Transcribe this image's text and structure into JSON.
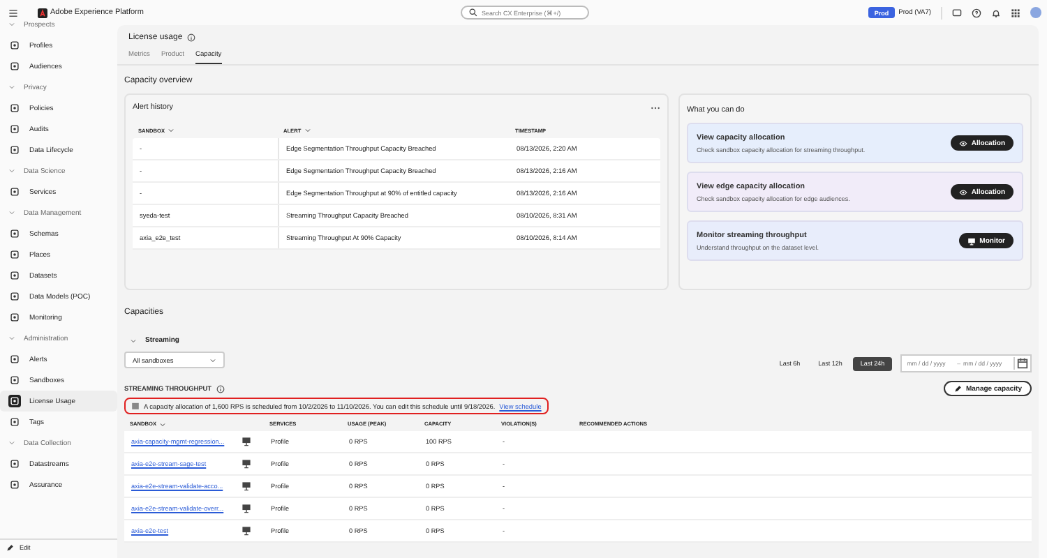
{
  "topbar": {
    "app_name": "Adobe Experience Platform",
    "search_placeholder": "Search CX Enterprise (⌘+/)",
    "env_badge": "Prod",
    "env_name": "Prod (VA7)"
  },
  "sidebar": {
    "sections": [
      {
        "title": "Prospects",
        "expanded": true,
        "items": [
          {
            "label": "Profiles",
            "selected": false
          },
          {
            "label": "Audiences",
            "selected": false
          }
        ]
      },
      {
        "title": "Privacy",
        "expanded": true,
        "items": [
          {
            "label": "Policies",
            "selected": false
          },
          {
            "label": "Audits",
            "selected": false
          },
          {
            "label": "Data Lifecycle",
            "selected": false
          }
        ]
      },
      {
        "title": "Data Science",
        "expanded": true,
        "items": [
          {
            "label": "Services",
            "selected": false
          }
        ]
      },
      {
        "title": "Data Management",
        "expanded": true,
        "items": [
          {
            "label": "Schemas",
            "selected": false
          },
          {
            "label": "Places",
            "selected": false
          },
          {
            "label": "Datasets",
            "selected": false
          },
          {
            "label": "Data Models (POC)",
            "selected": false
          },
          {
            "label": "Monitoring",
            "selected": false
          }
        ]
      },
      {
        "title": "Administration",
        "expanded": true,
        "items": [
          {
            "label": "Alerts",
            "selected": false
          },
          {
            "label": "Sandboxes",
            "selected": false
          },
          {
            "label": "License Usage",
            "selected": true
          },
          {
            "label": "Tags",
            "selected": false
          }
        ]
      },
      {
        "title": "Data Collection",
        "expanded": true,
        "items": [
          {
            "label": "Datastreams",
            "selected": false
          },
          {
            "label": "Assurance",
            "selected": false
          }
        ]
      }
    ],
    "edit_button": "Edit"
  },
  "page": {
    "title": "License usage",
    "tabs": [
      {
        "label": "Metrics",
        "selected": false
      },
      {
        "label": "Product",
        "selected": false
      },
      {
        "label": "Capacity",
        "selected": true
      }
    ],
    "section_title": "Capacity overview"
  },
  "alert_history": {
    "title": "Alert history",
    "columns": [
      {
        "label": "SANDBOX",
        "sortable": true
      },
      {
        "label": "ALERT",
        "sortable": true
      },
      {
        "label": "TIMESTAMP",
        "sortable": false
      }
    ],
    "rows": [
      [
        "-",
        "Edge Segmentation Throughput Capacity Breached",
        "08/13/2026, 2:20 AM"
      ],
      [
        "-",
        "Edge Segmentation Throughput Capacity Breached",
        "08/13/2026, 2:16 AM"
      ],
      [
        "-",
        "Edge Segmentation Throughput at 90% of entitled capacity",
        "08/13/2026, 2:16 AM"
      ],
      [
        "syeda-test",
        "Streaming Throughput Capacity Breached",
        "08/10/2026, 8:31 AM"
      ],
      [
        "axia_e2e_test",
        "Streaming Throughput At 90% Capacity",
        "08/10/2026, 8:14 AM"
      ]
    ]
  },
  "actions": {
    "title": "What you can do",
    "cards": [
      {
        "title": "View capacity allocation",
        "description": "Check sandbox capacity allocation for streaming throughput.",
        "button": "Allocation",
        "kind": "view",
        "color": "#e6eefc"
      },
      {
        "title": "View edge capacity allocation",
        "description": "Check sandbox capacity allocation for edge audiences.",
        "button": "Allocation",
        "kind": "view",
        "color": "#f1ecf9"
      },
      {
        "title": "Monitor streaming throughput",
        "description": "Understand throughput on the dataset level.",
        "button": "Monitor",
        "kind": "monitor",
        "color": "#e8edfb"
      }
    ]
  },
  "capacities": {
    "title": "Capacities",
    "group": {
      "label": "Streaming",
      "expanded": true
    },
    "sandbox_select": "All sandboxes",
    "time_ranges": [
      {
        "label": "Last 6h",
        "selected": false
      },
      {
        "label": "Last 12h",
        "selected": false
      },
      {
        "label": "Last 24h",
        "selected": true
      }
    ],
    "date_start_placeholder": "mm / dd / yyyy",
    "date_separator": "–",
    "date_end_placeholder": "mm / dd / yyyy",
    "throughput_title": "STREAMING THROUGHPUT",
    "manage_button": "Manage capacity",
    "notice": {
      "text": "A capacity allocation of 1,600 RPS is scheduled from 10/2/2026 to 11/10/2026. You can edit this schedule until 9/18/2026.",
      "link": "View schedule",
      "highlighted": true
    },
    "columns": [
      {
        "label": "SANDBOX",
        "sortable": true
      },
      {
        "label": "SERVICES",
        "sortable": false
      },
      {
        "label": "USAGE (PEAK)",
        "sortable": false
      },
      {
        "label": "CAPACITY",
        "sortable": false
      },
      {
        "label": "VIOLATION(S)",
        "sortable": false
      },
      {
        "label": "RECOMMENDED ACTIONS",
        "sortable": false
      }
    ],
    "rows": [
      {
        "sandbox": "axia-capacity-mgmt-regression...",
        "services": "Profile",
        "usage": "0 RPS",
        "capacity": "100 RPS",
        "violations": "-"
      },
      {
        "sandbox": "axia-e2e-stream-sage-test",
        "services": "Profile",
        "usage": "0 RPS",
        "capacity": "0 RPS",
        "violations": "-"
      },
      {
        "sandbox": "axia-e2e-stream-validate-acco...",
        "services": "Profile",
        "usage": "0 RPS",
        "capacity": "0 RPS",
        "violations": "-"
      },
      {
        "sandbox": "axia-e2e-stream-validate-overr...",
        "services": "Profile",
        "usage": "0 RPS",
        "capacity": "0 RPS",
        "violations": "-"
      },
      {
        "sandbox": "axia-e2e-test",
        "services": "Profile",
        "usage": "0 RPS",
        "capacity": "0 RPS",
        "violations": "-"
      }
    ]
  }
}
